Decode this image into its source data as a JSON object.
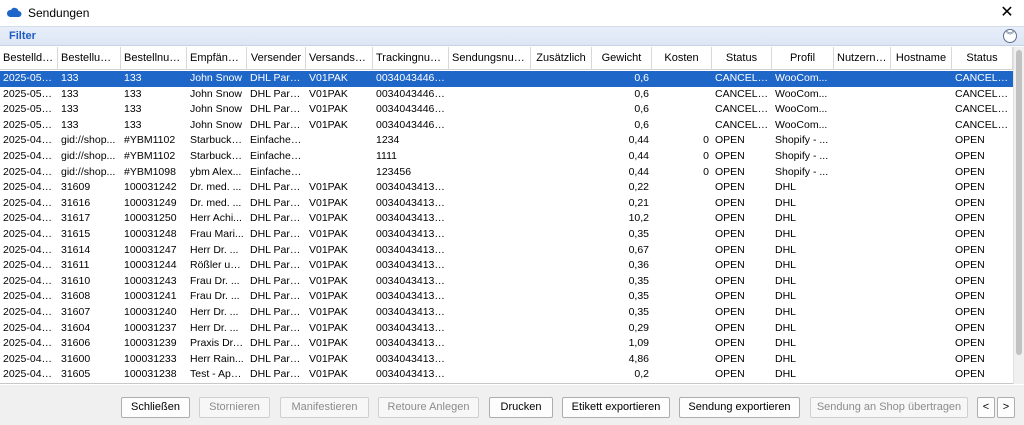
{
  "window": {
    "title": "Sendungen"
  },
  "filter": {
    "label": "Filter"
  },
  "columns": [
    {
      "label": "Bestelldat...",
      "w": 58
    },
    {
      "label": "Bestellung...",
      "w": 63
    },
    {
      "label": "Bestellnum...",
      "w": 66
    },
    {
      "label": "Empfänger",
      "w": 60
    },
    {
      "label": "Versender",
      "w": 59
    },
    {
      "label": "Versandser...",
      "w": 67
    },
    {
      "label": "Trackingnum...",
      "w": 76
    },
    {
      "label": "Sendungsnum...",
      "w": 82
    },
    {
      "label": "Zusätzlich",
      "w": 61
    },
    {
      "label": "Gewicht",
      "w": 60
    },
    {
      "label": "Kosten",
      "w": 60
    },
    {
      "label": "Status",
      "w": 60
    },
    {
      "label": "Profil",
      "w": 62
    },
    {
      "label": "Nutzerna...",
      "w": 57
    },
    {
      "label": "Hostname",
      "w": 61
    },
    {
      "label": "Status",
      "w": 61
    }
  ],
  "rows": [
    [
      "2025-05-0...",
      "133",
      "133",
      "John Snow",
      "DHL Parc...",
      "V01PAK",
      "003404344688...",
      "",
      "",
      "0,6",
      "",
      "CANCELL...",
      "WooCom...",
      "",
      "",
      "CANCELL..."
    ],
    [
      "2025-05-0...",
      "133",
      "133",
      "John Snow",
      "DHL Parc...",
      "V01PAK",
      "003404344688...",
      "",
      "",
      "0,6",
      "",
      "CANCELL...",
      "WooCom...",
      "",
      "",
      "CANCELL..."
    ],
    [
      "2025-05-0...",
      "133",
      "133",
      "John Snow",
      "DHL Parc...",
      "V01PAK",
      "003404344688...",
      "",
      "",
      "0,6",
      "",
      "CANCELL...",
      "WooCom...",
      "",
      "",
      "CANCELL..."
    ],
    [
      "2025-05-0...",
      "133",
      "133",
      "John Snow",
      "DHL Parc...",
      "V01PAK",
      "003404344688...",
      "",
      "",
      "0,6",
      "",
      "CANCELL...",
      "WooCom...",
      "",
      "",
      "CANCELL..."
    ],
    [
      "2025-04-3...",
      "gid://shop...",
      "#YBM1102",
      "Starbucks...",
      "Einfacher ...",
      "",
      "1234",
      "",
      "",
      "0,44",
      "0",
      "OPEN",
      "Shopify - ...",
      "",
      "",
      "OPEN"
    ],
    [
      "2025-04-2...",
      "gid://shop...",
      "#YBM1102",
      "Starbucks...",
      "Einfacher ...",
      "",
      "1111",
      "",
      "",
      "0,44",
      "0",
      "OPEN",
      "Shopify - ...",
      "",
      "",
      "OPEN"
    ],
    [
      "2025-04-2...",
      "gid://shop...",
      "#YBM1098",
      "ybm Alex...",
      "Einfacher ...",
      "",
      "123456",
      "",
      "",
      "0,44",
      "0",
      "OPEN",
      "Shopify - ...",
      "",
      "",
      "OPEN"
    ],
    [
      "2025-04-1...",
      "31609",
      "100031242",
      "Dr. med. ...",
      "DHL Parc...",
      "V01PAK",
      "003404341309...",
      "",
      "",
      "0,22",
      "",
      "OPEN",
      "DHL",
      "",
      "",
      "OPEN"
    ],
    [
      "2025-04-1...",
      "31616",
      "100031249",
      "Dr. med. ...",
      "DHL Parc...",
      "V01PAK",
      "003404341309...",
      "",
      "",
      "0,21",
      "",
      "OPEN",
      "DHL",
      "",
      "",
      "OPEN"
    ],
    [
      "2025-04-1...",
      "31617",
      "100031250",
      "Herr Achi...",
      "DHL Parc...",
      "V01PAK",
      "003404341309...",
      "",
      "",
      "10,2",
      "",
      "OPEN",
      "DHL",
      "",
      "",
      "OPEN"
    ],
    [
      "2025-04-1...",
      "31615",
      "100031248",
      "Frau Mari...",
      "DHL Parc...",
      "V01PAK",
      "003404341309...",
      "",
      "",
      "0,35",
      "",
      "OPEN",
      "DHL",
      "",
      "",
      "OPEN"
    ],
    [
      "2025-04-1...",
      "31614",
      "100031247",
      "Herr Dr. ...",
      "DHL Parc...",
      "V01PAK",
      "003404341309...",
      "",
      "",
      "0,67",
      "",
      "OPEN",
      "DHL",
      "",
      "",
      "OPEN"
    ],
    [
      "2025-04-1...",
      "31611",
      "100031244",
      "Rößler un...",
      "DHL Parc...",
      "V01PAK",
      "003404341309...",
      "",
      "",
      "0,36",
      "",
      "OPEN",
      "DHL",
      "",
      "",
      "OPEN"
    ],
    [
      "2025-04-1...",
      "31610",
      "100031243",
      "Frau Dr. ...",
      "DHL Parc...",
      "V01PAK",
      "003404341309...",
      "",
      "",
      "0,35",
      "",
      "OPEN",
      "DHL",
      "",
      "",
      "OPEN"
    ],
    [
      "2025-04-1...",
      "31608",
      "100031241",
      "Frau Dr. ...",
      "DHL Parc...",
      "V01PAK",
      "003404341309...",
      "",
      "",
      "0,35",
      "",
      "OPEN",
      "DHL",
      "",
      "",
      "OPEN"
    ],
    [
      "2025-04-1...",
      "31607",
      "100031240",
      "Herr Dr. ...",
      "DHL Parc...",
      "V01PAK",
      "003404341309...",
      "",
      "",
      "0,35",
      "",
      "OPEN",
      "DHL",
      "",
      "",
      "OPEN"
    ],
    [
      "2025-04-1...",
      "31604",
      "100031237",
      "Herr Dr. ...",
      "DHL Parc...",
      "V01PAK",
      "003404341309...",
      "",
      "",
      "0,29",
      "",
      "OPEN",
      "DHL",
      "",
      "",
      "OPEN"
    ],
    [
      "2025-04-1...",
      "31606",
      "100031239",
      "Praxis Dr. ...",
      "DHL Parc...",
      "V01PAK",
      "003404341309...",
      "",
      "",
      "1,09",
      "",
      "OPEN",
      "DHL",
      "",
      "",
      "OPEN"
    ],
    [
      "2025-04-1...",
      "31600",
      "100031233",
      "Herr Rain...",
      "DHL Parc...",
      "V01PAK",
      "003404341309...",
      "",
      "",
      "4,86",
      "",
      "OPEN",
      "DHL",
      "",
      "",
      "OPEN"
    ],
    [
      "2025-04-1...",
      "31605",
      "100031238",
      "Test - Apo...",
      "DHL Parc...",
      "V01PAK",
      "003404341309...",
      "",
      "",
      "0,2",
      "",
      "OPEN",
      "DHL",
      "",
      "",
      "OPEN"
    ]
  ],
  "right_aligned_columns": [
    9,
    10
  ],
  "selected_row": 0,
  "buttons": {
    "close": "Schließen",
    "cancel": "Stornieren",
    "manifest": "Manifestieren",
    "return": "Retoure Anlegen",
    "print": "Drucken",
    "export_label": "Etikett exportieren",
    "export_shipment": "Sendung exportieren",
    "transfer": "Sendung an Shop übertragen",
    "prev": "<",
    "next": ">"
  },
  "colors": {
    "selection": "#1f66c9",
    "filter_text": "#1f5cc2"
  }
}
